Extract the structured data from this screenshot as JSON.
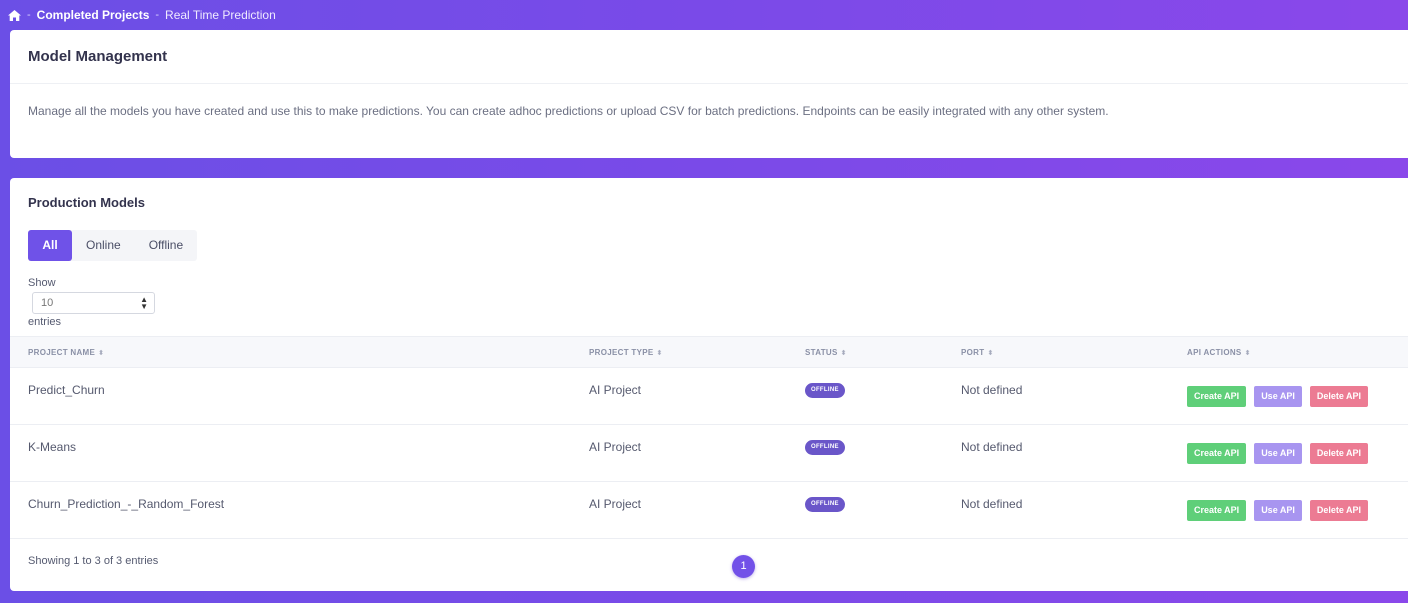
{
  "breadcrumb": {
    "items": [
      "Completed Projects",
      "Real Time Prediction"
    ],
    "separator": "-"
  },
  "management": {
    "title": "Model Management",
    "description": "Manage all the models you have created and use this to make predictions. You can create adhoc predictions or upload CSV for batch predictions. Endpoints can be easily integrated with any other system."
  },
  "production": {
    "title": "Production Models",
    "tabs": [
      "All",
      "Online",
      "Offline"
    ],
    "active_tab": "All",
    "show_label": "Show",
    "page_size": "10",
    "entries_label": "entries",
    "columns": [
      "PROJECT NAME",
      "PROJECT TYPE",
      "STATUS",
      "PORT",
      "API ACTIONS"
    ],
    "rows": [
      {
        "name": "Predict_Churn",
        "type": "AI Project",
        "status": "OFFLINE",
        "port": "Not defined"
      },
      {
        "name": "K-Means",
        "type": "AI Project",
        "status": "OFFLINE",
        "port": "Not defined"
      },
      {
        "name": "Churn_Prediction_-_Random_Forest",
        "type": "AI Project",
        "status": "OFFLINE",
        "port": "Not defined"
      }
    ],
    "actions": {
      "create": "Create API",
      "use": "Use API",
      "delete": "Delete API"
    },
    "footer": "Showing 1 to 3 of 3 entries",
    "page": "1"
  },
  "colors": {
    "accent": "#6f52e8",
    "create": "#5fcf79",
    "use": "#a895f0",
    "delete": "#ec7b93",
    "badge": "#6a56c9"
  },
  "icons": {
    "home": "home-icon",
    "sort": "sort-icon"
  }
}
